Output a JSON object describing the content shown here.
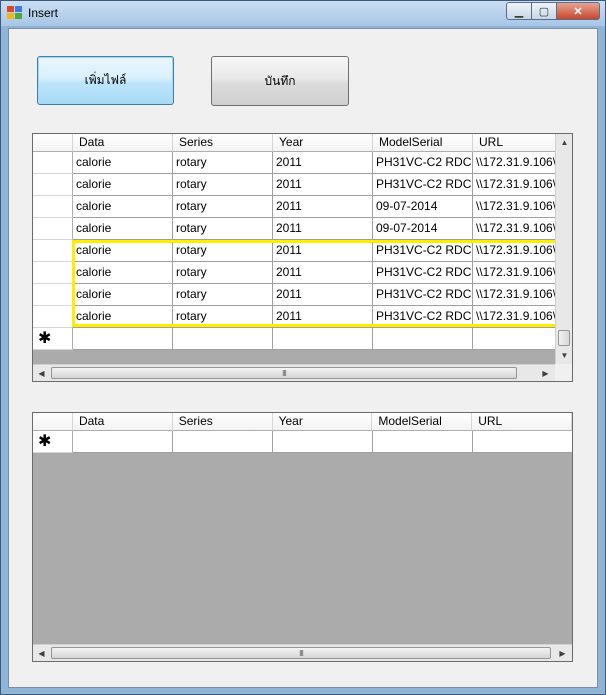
{
  "window": {
    "title": "Insert"
  },
  "toolbar": {
    "add_file_label": "เพิ่มไฟล์",
    "save_label": "บันทึก"
  },
  "grid_top": {
    "columns": [
      "Data",
      "Series",
      "Year",
      "ModelSerial",
      "URL"
    ],
    "rows": [
      [
        "calorie",
        "rotary",
        "2011",
        "PH31VC-C2 RDC...",
        "\\\\172.31.9.106\\"
      ],
      [
        "calorie",
        "rotary",
        "2011",
        "PH31VC-C2 RDC...",
        "\\\\172.31.9.106\\"
      ],
      [
        "calorie",
        "rotary",
        "2011",
        "09-07-2014",
        "\\\\172.31.9.106\\"
      ],
      [
        "calorie",
        "rotary",
        "2011",
        "09-07-2014",
        "\\\\172.31.9.106\\"
      ],
      [
        "calorie",
        "rotary",
        "2011",
        "PH31VC-C2 RDC...",
        "\\\\172.31.9.106\\"
      ],
      [
        "calorie",
        "rotary",
        "2011",
        "PH31VC-C2 RDC...",
        "\\\\172.31.9.106\\"
      ],
      [
        "calorie",
        "rotary",
        "2011",
        "PH31VC-C2 RDC...",
        "\\\\172.31.9.106\\"
      ],
      [
        "calorie",
        "rotary",
        "2011",
        "PH31VC-C2 RDC...",
        "\\\\172.31.9.106\\"
      ]
    ],
    "new_row_marker": "✱",
    "highlight_color": "#ffee00"
  },
  "grid_bottom": {
    "columns": [
      "Data",
      "Series",
      "Year",
      "ModelSerial",
      "URL"
    ],
    "rows": [],
    "new_row_marker": "✱"
  },
  "icons": {
    "scroll_left": "◀",
    "scroll_right": "▶",
    "scroll_up": "▲",
    "scroll_down": "▼",
    "grip": "III"
  }
}
